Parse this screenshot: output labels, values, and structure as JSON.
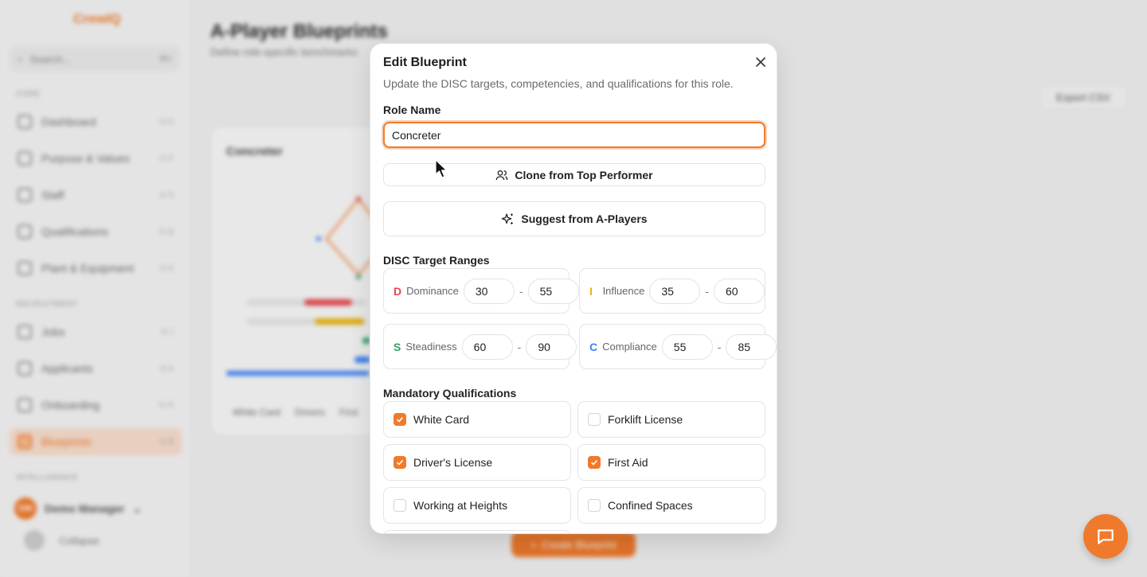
{
  "background": {
    "brand": "CrewIQ",
    "search_placeholder": "Search...",
    "search_shortcut": "⌘K",
    "sections": [
      "CORE",
      "RECRUITMENT",
      "INTELLIGENCE"
    ],
    "nav": [
      {
        "label": "Dashboard",
        "shortcut": "G D"
      },
      {
        "label": "Purpose & Values",
        "shortcut": "G P"
      },
      {
        "label": "Staff",
        "shortcut": "G S"
      },
      {
        "label": "Qualifications",
        "shortcut": "G Q"
      },
      {
        "label": "Plant & Equipment",
        "shortcut": "G E"
      },
      {
        "label": "Jobs",
        "shortcut": "G J"
      },
      {
        "label": "Applicants",
        "shortcut": "G A"
      },
      {
        "label": "Onboarding",
        "shortcut": "G O"
      },
      {
        "label": "Blueprints",
        "shortcut": "G B"
      }
    ],
    "user": {
      "initials": "DM",
      "name": "Demo Manager"
    },
    "collapse_label": "Collapse",
    "page_title": "A-Player Blueprints",
    "page_subtitle": "Define role-specific benchmarks",
    "export_label": "Export CSV",
    "card_title": "Concreter",
    "card_tags": [
      "White Card",
      "Drivers",
      "First"
    ],
    "create_label": "Create Blueprint"
  },
  "modal": {
    "title": "Edit Blueprint",
    "description": "Update the DISC targets, competencies, and qualifications for this role.",
    "role_name_label": "Role Name",
    "role_name_value": "Concreter",
    "clone_label": "Clone from Top Performer",
    "suggest_label": "Suggest from A-Players",
    "disc_label": "DISC Target Ranges",
    "disc": [
      {
        "letter": "D",
        "name": "Dominance",
        "min": "30",
        "max": "55",
        "color": "#e5484d"
      },
      {
        "letter": "I",
        "name": "Influence",
        "min": "35",
        "max": "60",
        "color": "#e8b40f"
      },
      {
        "letter": "S",
        "name": "Steadiness",
        "min": "60",
        "max": "90",
        "color": "#30a46c"
      },
      {
        "letter": "C",
        "name": "Compliance",
        "min": "55",
        "max": "85",
        "color": "#3b82f6"
      }
    ],
    "qual_label": "Mandatory Qualifications",
    "qualifications": [
      {
        "label": "White Card",
        "checked": true
      },
      {
        "label": "Forklift License",
        "checked": false
      },
      {
        "label": "Driver's License",
        "checked": true
      },
      {
        "label": "First Aid",
        "checked": true
      },
      {
        "label": "Working at Heights",
        "checked": false
      },
      {
        "label": "Confined Spaces",
        "checked": false
      }
    ]
  },
  "colors": {
    "accent": "#f07a2c"
  }
}
